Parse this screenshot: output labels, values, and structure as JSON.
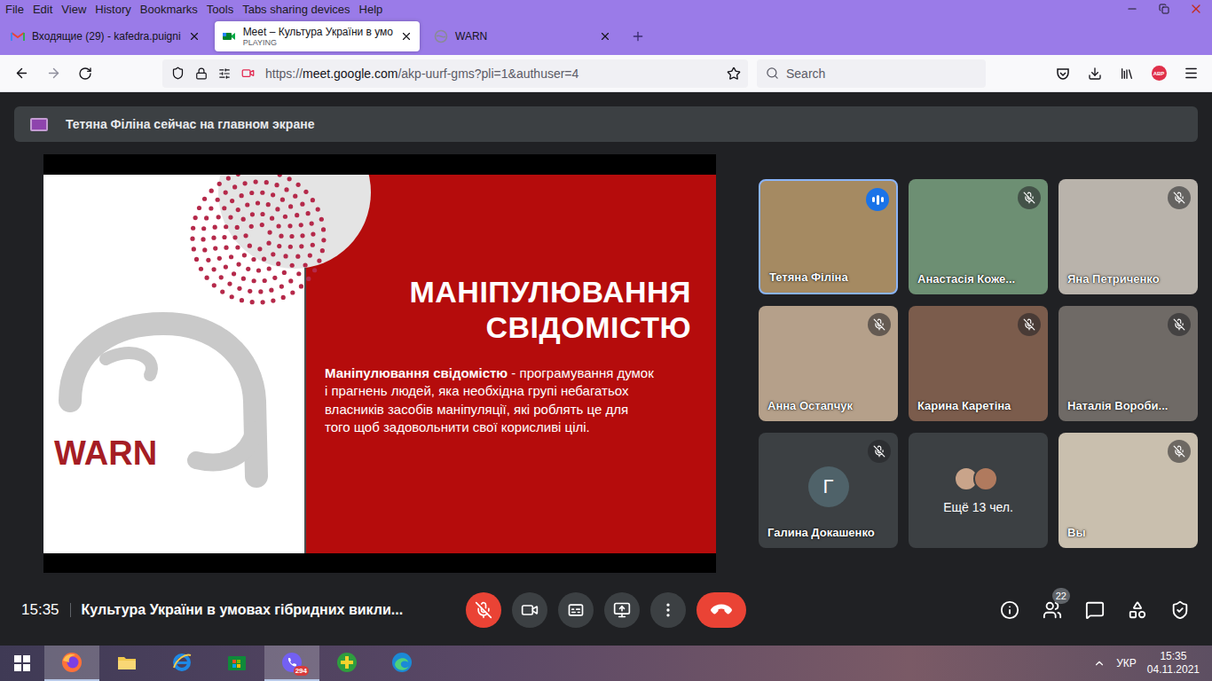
{
  "menu_bar": {
    "items": [
      "File",
      "Edit",
      "View",
      "History",
      "Bookmarks",
      "Tools",
      "Tabs sharing devices",
      "Help"
    ]
  },
  "tabs": [
    {
      "label": "Входящие (29) - kafedra.puigni",
      "selected": false
    },
    {
      "label": "Meet – Культура України в умо",
      "status": "PLAYING",
      "selected": true
    },
    {
      "label": "WARN",
      "selected": false
    }
  ],
  "address_bar": {
    "url_scheme": "https://",
    "url_host": "meet.google.com",
    "url_path": "/akp-uurf-gms?pli=1&authuser=4",
    "bookmarked": false
  },
  "search": {
    "placeholder": "Search"
  },
  "toolbar": {
    "extension_badge": "ABP"
  },
  "meet": {
    "banner": "Тетяна Філіна сейчас на главном экране",
    "slide": {
      "logo": "WARN",
      "title_lines": [
        "МАНІПУЛЮВАННЯ",
        "СВІДОМІСТЮ"
      ],
      "term": "Маніпулювання свідомістю",
      "definition": " - програмування думок і прагнень людей, яка необхідна групі небагатьох власників засобів маніпуляції, які роблять це для того щоб задовольнити свої корисливі цілі."
    },
    "participants": [
      {
        "name": "Тетяна Філіна",
        "kind": "video",
        "color": "#a58a62",
        "muted": false,
        "speaking": true
      },
      {
        "name": "Анастасія Коже...",
        "kind": "video",
        "color": "#6d8f73",
        "muted": true,
        "speaking": false
      },
      {
        "name": "Яна Петриченко",
        "kind": "video",
        "color": "#b9b3ab",
        "muted": true,
        "speaking": false
      },
      {
        "name": "Анна Остапчук",
        "kind": "video",
        "color": "#b5a08a",
        "muted": true,
        "speaking": false
      },
      {
        "name": "Карина Каретіна",
        "kind": "video",
        "color": "#7b5c4c",
        "muted": true,
        "speaking": false
      },
      {
        "name": "Наталія Вороби...",
        "kind": "video",
        "color": "#6f6a66",
        "muted": true,
        "speaking": false
      },
      {
        "name": "Галина Докашенко",
        "kind": "avatar",
        "initial": "Г",
        "color": "#4f6269",
        "muted": true,
        "speaking": false
      },
      {
        "name": "Ещё 13 чел.",
        "kind": "more",
        "avatar_colors": [
          "#c9a48a",
          "#b07a5e"
        ],
        "muted": false,
        "speaking": false
      },
      {
        "name": "Вы",
        "kind": "video",
        "color": "#c9bfae",
        "muted": true,
        "speaking": false
      }
    ],
    "time": "15:35",
    "meeting_title": "Культура України в умовах гібридних викли...",
    "controls": {
      "microphone_on": false,
      "camera_on": true,
      "captions_on": false
    },
    "people_count": "22"
  },
  "taskbar": {
    "apps": [
      {
        "selected": true
      },
      {
        "selected": false
      },
      {
        "selected": false
      },
      {
        "selected": false
      },
      {
        "selected": true,
        "badge": "294"
      },
      {
        "selected": false
      },
      {
        "selected": false
      }
    ],
    "language": "УКР",
    "time": "15:35",
    "date": "04.11.2021"
  }
}
